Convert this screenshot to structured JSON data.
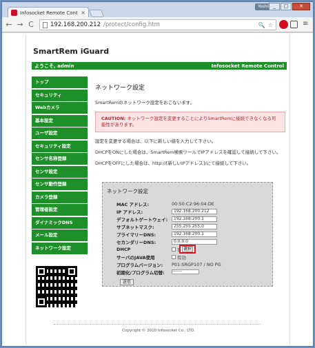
{
  "browser": {
    "tab_title": "Infosocket Remote Contr",
    "tab_close": "×",
    "user_badge": "Yoshiken",
    "url_host": "192.168.200.212",
    "url_path": "/protect/config.htm",
    "back": "←",
    "forward": "→",
    "reload": "C",
    "search_glyph": "🔍",
    "star_glyph": "☆",
    "menu_glyph": "≡"
  },
  "header": {
    "brand": "SmartRem iGuard",
    "welcome": "ようこそ, admin",
    "company": "Infosocket Remote Control"
  },
  "sidebar": {
    "items": [
      {
        "label": "トップ"
      },
      {
        "label": "セキュリティ"
      },
      {
        "label": "Webカメラ"
      },
      {
        "label": "基本設定"
      },
      {
        "label": "ユーザ設定"
      },
      {
        "label": "セキュリティ設定"
      },
      {
        "label": "センサ名称登録"
      },
      {
        "label": "センサ設定"
      },
      {
        "label": "センサ動作登録"
      },
      {
        "label": "カメラ登録"
      },
      {
        "label": "管理者設定"
      },
      {
        "label": "ダイナミックDNS"
      },
      {
        "label": "メール設定"
      },
      {
        "label": "ネットワーク設定"
      }
    ]
  },
  "main": {
    "title": "ネットワーク設定",
    "intro": "SmartRemのネットワーク設定をおこないます。",
    "caution_label": "CAUTION:",
    "caution_text": "ネットワーク設定を変更することによりSmartRemに接続できなくなる可能性があります。",
    "para1": "設定を変更する場合は、以下に新しい値を入力して下さい。",
    "para2": "DHCPをONにした場合は、SmartRem検索ツールでIPアドレスを確認して接続して下さい。",
    "para3": "DHCPをOFFにした場合は、http://[新しいIPアドレス]/にて接続して下さい。"
  },
  "form": {
    "title": "ネットワーク設定",
    "mac_label": "MAC アドレス:",
    "mac_value": "00:50:C2:96:04:DE",
    "ip_label": "IP アドレス:",
    "ip_value": "192.168.200.212",
    "gw_label": "デフォルトゲートウェイ:",
    "gw_value": "192.168.200.1",
    "gw_button": "選択",
    "mask_label": "サブネットマスク:",
    "mask_value": "255.255.255.0",
    "dns1_label": "プライマリーDNS:",
    "dns1_value": "192.168.200.1",
    "dns2_label": "セカンダリーDNS:",
    "dns2_value": "0.0.0.0",
    "dhcp_label": "DHCP",
    "dhcp_option": "有効",
    "java_label": "サーバのJAVA使用",
    "java_option": "有効",
    "version_label": "プログラムバージョン:",
    "version_value": "P01:SRGP107 / NO PG",
    "init_label": "初期化/プログラム切替:",
    "init_select": "--------",
    "submit": "送信"
  },
  "footer": {
    "copyright": "Copyright © 2010 Infosocket Co., LTD."
  }
}
